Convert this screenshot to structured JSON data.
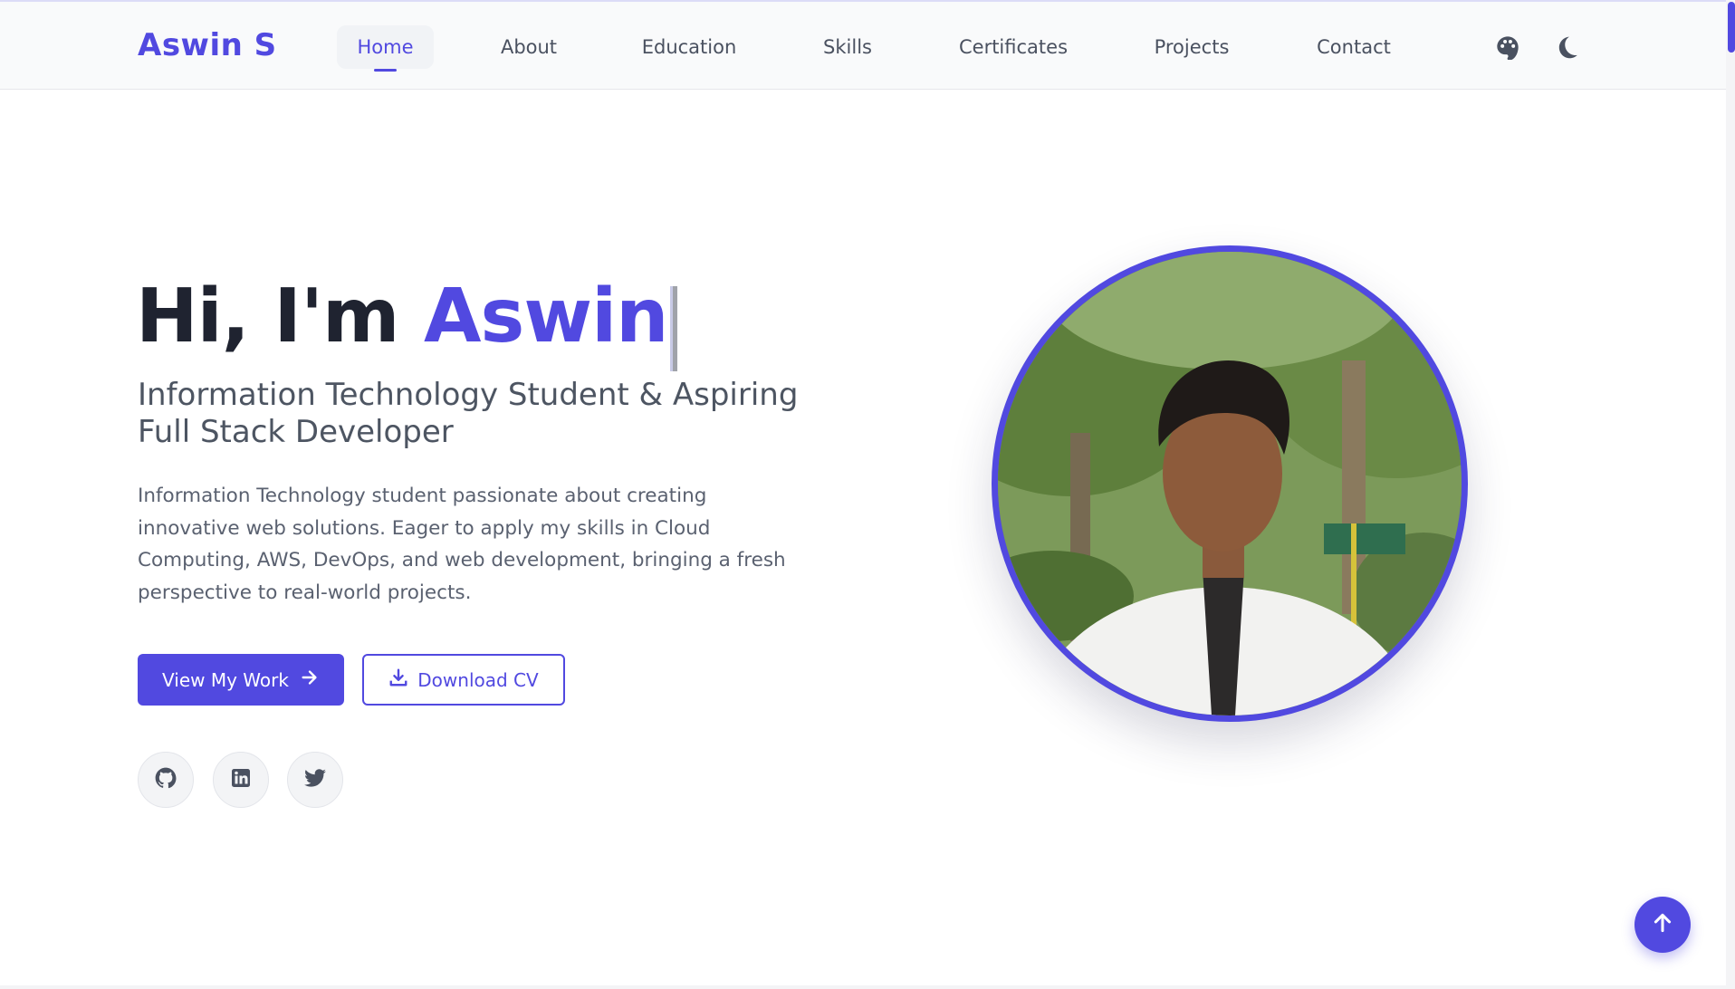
{
  "brand": "Aswin S",
  "nav": {
    "items": [
      {
        "label": "Home"
      },
      {
        "label": "About"
      },
      {
        "label": "Education"
      },
      {
        "label": "Skills"
      },
      {
        "label": "Certificates"
      },
      {
        "label": "Projects"
      },
      {
        "label": "Contact"
      }
    ],
    "active": "Home",
    "icons": [
      "palette-icon",
      "moon-icon"
    ]
  },
  "hero": {
    "greeting": "Hi, I'm ",
    "name": "Aswin",
    "subtitle": "Information Technology Student & Aspiring Full Stack Developer",
    "description": "Information Technology student passionate about creating innovative web solutions. Eager to apply my skills in Cloud Computing, AWS, DevOps, and web development, bringing a fresh perspective to real-world projects.",
    "primary_button": "View My Work",
    "secondary_button": "Download CV",
    "socials": [
      "github-icon",
      "linkedin-icon",
      "twitter-icon"
    ]
  },
  "colors": {
    "accent": "#5149e0",
    "text": "#1f2330",
    "muted": "#5a6170"
  }
}
